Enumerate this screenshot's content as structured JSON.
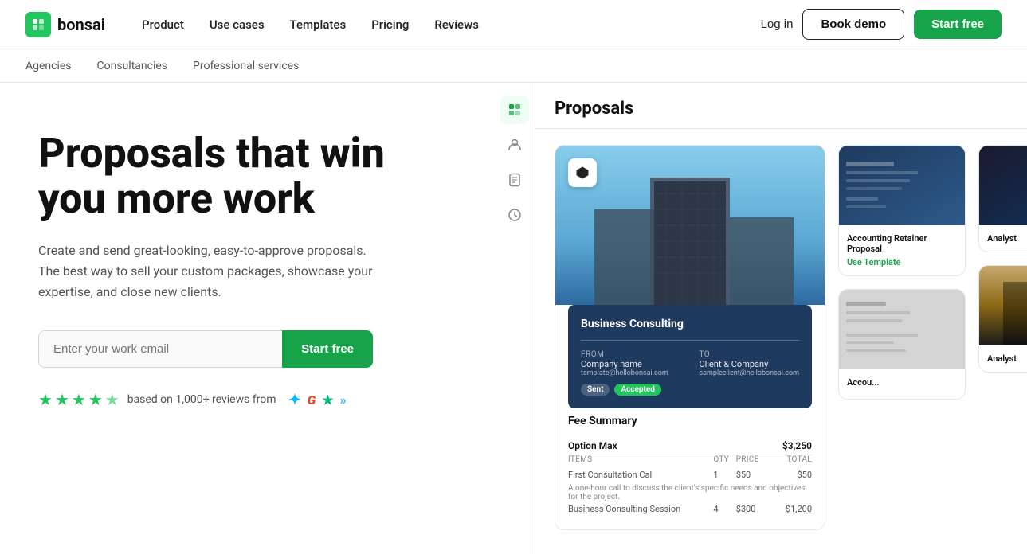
{
  "brand": {
    "name": "bonsai",
    "logo_alt": "Bonsai logo"
  },
  "nav": {
    "links": [
      {
        "id": "product",
        "label": "Product"
      },
      {
        "id": "use-cases",
        "label": "Use cases"
      },
      {
        "id": "templates",
        "label": "Templates"
      },
      {
        "id": "pricing",
        "label": "Pricing"
      },
      {
        "id": "reviews",
        "label": "Reviews"
      }
    ],
    "login_label": "Log in",
    "demo_label": "Book demo",
    "start_label": "Start free"
  },
  "subnav": {
    "items": [
      {
        "id": "agencies",
        "label": "Agencies"
      },
      {
        "id": "consultancies",
        "label": "Consultancies"
      },
      {
        "id": "professional-services",
        "label": "Professional services"
      }
    ]
  },
  "hero": {
    "title": "Proposals that win you more work",
    "subtitle": "Create and send great-looking, easy-to-approve proposals. The best way to sell your custom packages, showcase your expertise, and close new clients.",
    "email_placeholder": "Enter your work email",
    "start_label": "Start free",
    "reviews_text": "based on 1,000+ reviews from"
  },
  "app": {
    "panel_title": "Proposals",
    "sidebar_icons": [
      "grid",
      "user",
      "document",
      "clock"
    ],
    "proposal_title": "Business Consulting",
    "proposal_from_label": "FROM",
    "proposal_to_label": "TO",
    "proposal_from_company": "Company name",
    "proposal_to_company": "Client & Company",
    "proposal_from_email": "template@hellobonsai.com",
    "proposal_to_email": "sampleclient@hellobonsai.com",
    "status_sent": "Sent",
    "status_accepted": "Accepted",
    "fee_summary_title": "Fee Summary",
    "fee_option": "Option Max",
    "fee_option_price": "$3,250",
    "fee_col_items": "ITEMS",
    "fee_col_qty": "QTY",
    "fee_col_price": "PRICE",
    "fee_col_total": "TOTAL",
    "fee_row1_label": "First Consultation Call",
    "fee_row1_qty": "1",
    "fee_row1_price": "$50",
    "fee_row1_total": "$50",
    "fee_row1_note": "A one-hour call to discuss the client's specific needs and objectives for the project.",
    "fee_row2_label": "Business Consulting Session",
    "fee_row2_qty": "4",
    "fee_row2_price": "$300",
    "fee_row2_total": "$1,200",
    "template_card1_title": "Accounting Retainer Proposal",
    "template_card1_link": "Use Template",
    "template_card2_title": "Accou...",
    "analyst_card_title": "Analyst",
    "analyst_card2_title": "Analyst"
  },
  "colors": {
    "green": "#16a34a",
    "green_light": "#22c55e",
    "navy": "#1e3a5f"
  }
}
